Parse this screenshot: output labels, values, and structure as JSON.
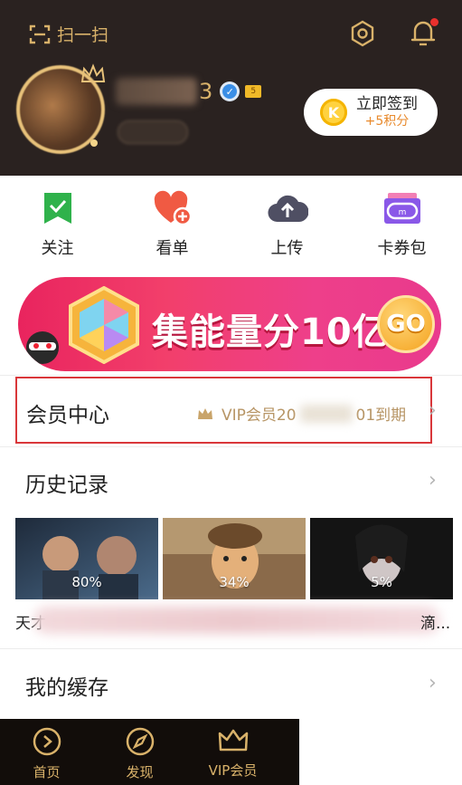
{
  "header": {
    "scan_label": "扫一扫",
    "username_tail": "3",
    "level_badge": "5",
    "checkin": {
      "title": "立即签到",
      "reward": "+5积分",
      "coin_letter": "K"
    }
  },
  "actions": [
    {
      "label": "关注",
      "icon": "bookmark-check-icon",
      "color": "#2fb24b"
    },
    {
      "label": "看单",
      "icon": "heart-plus-icon",
      "color": "#f05a43"
    },
    {
      "label": "上传",
      "icon": "cloud-upload-icon",
      "color": "#4f4f63"
    },
    {
      "label": "卡券包",
      "icon": "ticket-icon",
      "color": "#8a58e8"
    }
  ],
  "banner": {
    "text": "集能量分10亿",
    "go": "GO"
  },
  "member": {
    "title": "会员中心",
    "vip_prefix": "VIP会员20",
    "vip_suffix": "01到期"
  },
  "history": {
    "title": "历史记录",
    "items": [
      {
        "progress": "80%"
      },
      {
        "progress": "34%"
      },
      {
        "progress": "5%"
      }
    ],
    "caption_left": "天才",
    "caption_right": "滴..."
  },
  "cache": {
    "title": "我的缓存"
  },
  "tabbar": [
    {
      "label": "首页",
      "icon": "play-circle-icon"
    },
    {
      "label": "发现",
      "icon": "compass-icon"
    },
    {
      "label": "VIP会员",
      "icon": "crown-icon"
    }
  ],
  "colors": {
    "gold": "#d9b26a",
    "header_bg": "#2a2220",
    "highlight": "#d9373a"
  }
}
